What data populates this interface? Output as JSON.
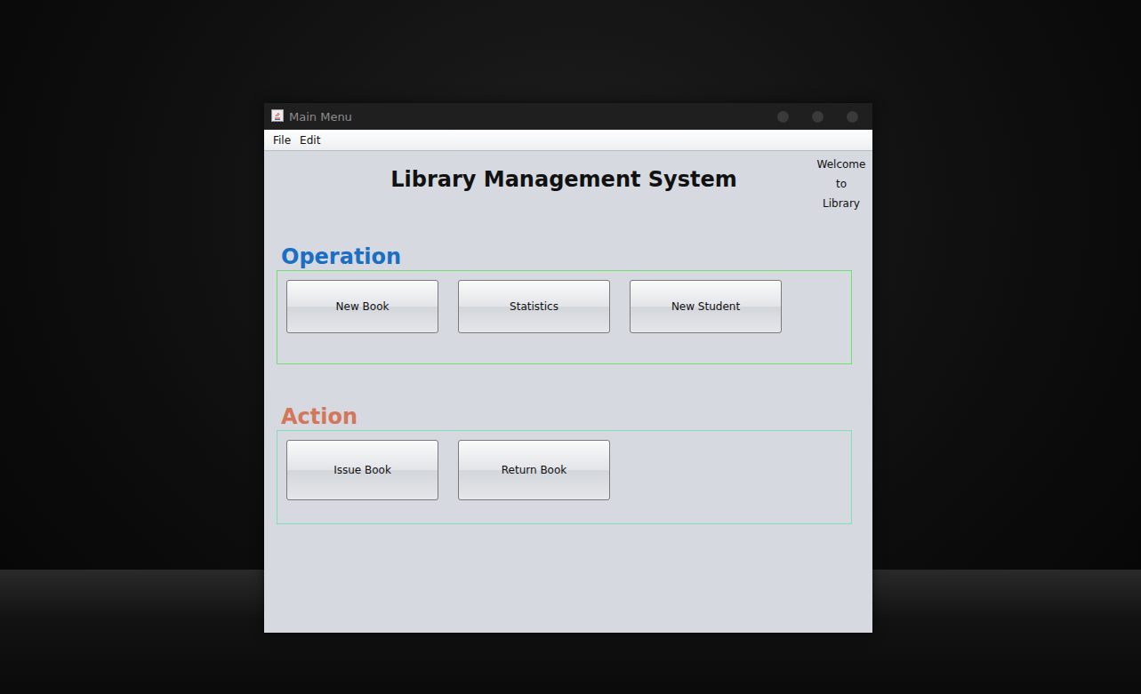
{
  "window": {
    "title": "Main Menu"
  },
  "menu": [
    "File",
    "Edit"
  ],
  "header": {
    "title": "Library Management System",
    "welcome": [
      "Welcome",
      "to",
      "Library"
    ]
  },
  "sections": [
    {
      "title": "Operation",
      "color": "#1a6fc4",
      "border": "#6fe06f",
      "buttons": [
        "New Book",
        "Statistics",
        "New Student"
      ]
    },
    {
      "title": "Action",
      "color": "#d2775a",
      "border": "#7fe0b8",
      "buttons": [
        "Issue Book",
        "Return Book"
      ]
    }
  ]
}
